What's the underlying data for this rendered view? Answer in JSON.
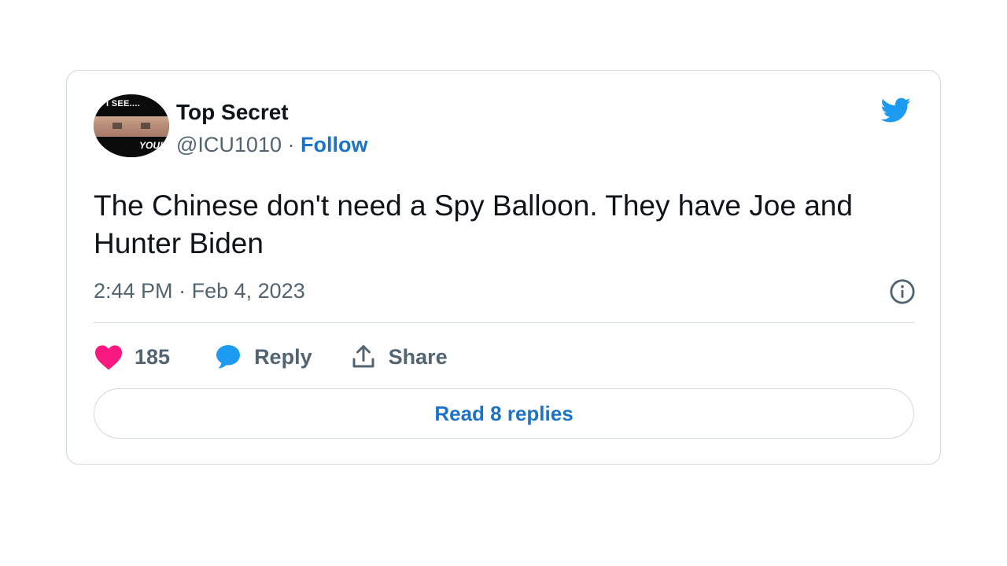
{
  "tweet": {
    "avatar": {
      "top_text": "I SEE....",
      "bottom_text": "YOU!"
    },
    "author_name": "Top Secret",
    "handle": "@ICU1010",
    "separator": "·",
    "follow_label": "Follow",
    "text": "The Chinese don't need a Spy Balloon. They have Joe and Hunter Biden",
    "time": "2:44 PM",
    "date": "Feb 4, 2023",
    "meta_separator": "·",
    "likes": "185",
    "reply_label": "Reply",
    "share_label": "Share",
    "read_replies_label": "Read 8 replies"
  },
  "colors": {
    "link": "#1d74c7",
    "twitter_blue": "#1d9bf0",
    "like_pink": "#f91880",
    "muted_text": "#536471",
    "border": "#cfd9de"
  },
  "icons": {
    "brand": "twitter-bird-icon",
    "info": "info-icon",
    "like": "heart-icon",
    "reply": "speech-bubble-icon",
    "share": "share-upload-icon"
  }
}
